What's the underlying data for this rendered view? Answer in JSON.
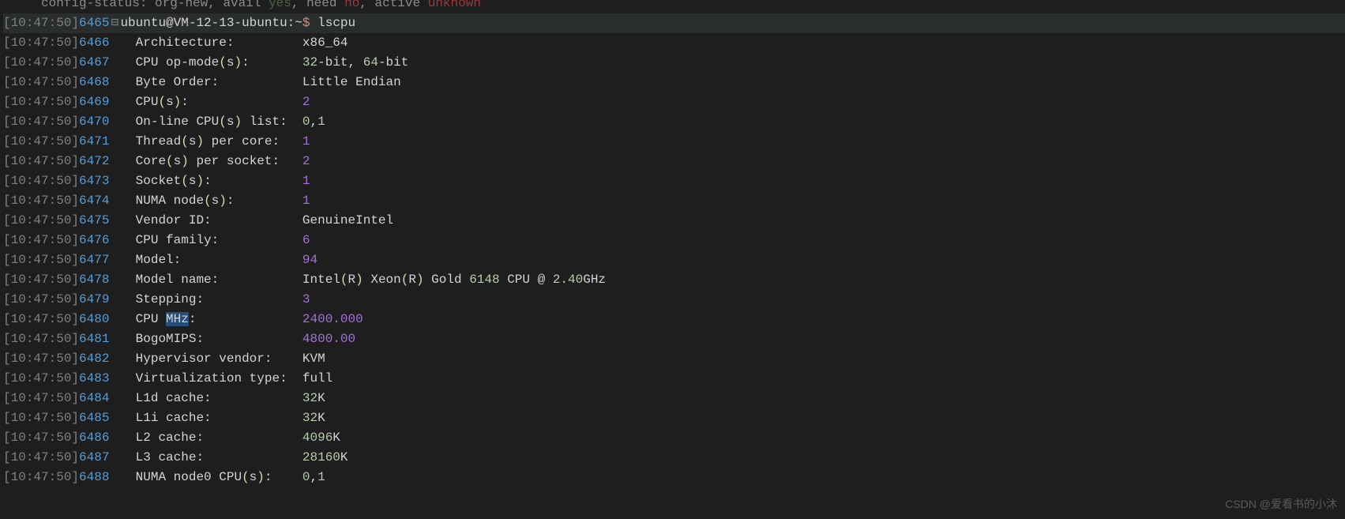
{
  "timestamp": "10:47:50",
  "first_line_no": 6465,
  "top_fragment": {
    "prefix": "     config-status: org-new, avail ",
    "yes": "yes",
    "mid1": ", need ",
    "no": "no",
    "mid2": ", active ",
    "unknown": "unknown"
  },
  "prompt": {
    "user": "ubuntu@VM-12-13-ubuntu",
    "path": "~",
    "dollar": "$",
    "cmd": "lscpu"
  },
  "rows": [
    {
      "label": "Architecture:",
      "value": "x86_64",
      "vtype": "text"
    },
    {
      "label_pre": "CPU op-mode",
      "paren": "s",
      "label_post": ":",
      "value_parts": [
        {
          "t": "num",
          "v": "32"
        },
        {
          "t": "text",
          "v": "-bit, "
        },
        {
          "t": "num",
          "v": "64"
        },
        {
          "t": "text",
          "v": "-bit"
        }
      ]
    },
    {
      "label": "Byte Order:",
      "value": "Little Endian",
      "vtype": "text"
    },
    {
      "label_pre": "CPU",
      "paren": "s",
      "label_post": ":",
      "value": "2",
      "vtype": "numv"
    },
    {
      "label_pre": "On-line CPU",
      "paren": "s",
      "label_post": " list:",
      "value_parts": [
        {
          "t": "num",
          "v": "0"
        },
        {
          "t": "text",
          "v": ","
        },
        {
          "t": "num",
          "v": "1"
        }
      ]
    },
    {
      "label_pre": "Thread",
      "paren": "s",
      "label_post": " per core:",
      "value": "1",
      "vtype": "numv"
    },
    {
      "label_pre": "Core",
      "paren": "s",
      "label_post": " per socket:",
      "value": "2",
      "vtype": "numv"
    },
    {
      "label_pre": "Socket",
      "paren": "s",
      "label_post": ":",
      "value": "1",
      "vtype": "numv"
    },
    {
      "label_pre": "NUMA node",
      "paren": "s",
      "label_post": ":",
      "value": "1",
      "vtype": "numv"
    },
    {
      "label": "Vendor ID:",
      "value": "GenuineIntel",
      "vtype": "text"
    },
    {
      "label": "CPU family:",
      "value": "6",
      "vtype": "numv"
    },
    {
      "label": "Model:",
      "value": "94",
      "vtype": "numv"
    },
    {
      "label": "Model name:",
      "value_parts": [
        {
          "t": "text",
          "v": "Intel"
        },
        {
          "t": "paren",
          "v": "("
        },
        {
          "t": "text",
          "v": "R"
        },
        {
          "t": "paren",
          "v": ")"
        },
        {
          "t": "text",
          "v": " Xeon"
        },
        {
          "t": "paren",
          "v": "("
        },
        {
          "t": "text",
          "v": "R"
        },
        {
          "t": "paren",
          "v": ")"
        },
        {
          "t": "text",
          "v": " Gold "
        },
        {
          "t": "num",
          "v": "6148"
        },
        {
          "t": "text",
          "v": " CPU @ "
        },
        {
          "t": "num",
          "v": "2.40"
        },
        {
          "t": "text",
          "v": "GHz"
        }
      ]
    },
    {
      "label": "Stepping:",
      "value": "3",
      "vtype": "numv"
    },
    {
      "label_pre": "CPU ",
      "highlight": "MHz",
      "label_post": ":",
      "value": "2400.000",
      "vtype": "numv"
    },
    {
      "label": "BogoMIPS:",
      "value": "4800.00",
      "vtype": "numv"
    },
    {
      "label": "Hypervisor vendor:",
      "value": "KVM",
      "vtype": "text"
    },
    {
      "label": "Virtualization type:",
      "value": "full",
      "vtype": "text"
    },
    {
      "label": "L1d cache:",
      "value_parts": [
        {
          "t": "num",
          "v": "32"
        },
        {
          "t": "text",
          "v": "K"
        }
      ]
    },
    {
      "label": "L1i cache:",
      "value_parts": [
        {
          "t": "num",
          "v": "32"
        },
        {
          "t": "text",
          "v": "K"
        }
      ]
    },
    {
      "label": "L2 cache:",
      "value_parts": [
        {
          "t": "num",
          "v": "4096"
        },
        {
          "t": "text",
          "v": "K"
        }
      ]
    },
    {
      "label": "L3 cache:",
      "value_parts": [
        {
          "t": "num",
          "v": "28160"
        },
        {
          "t": "text",
          "v": "K"
        }
      ]
    },
    {
      "label_pre": "NUMA node0 CPU",
      "paren": "s",
      "label_post": ":",
      "value_parts": [
        {
          "t": "num",
          "v": "0"
        },
        {
          "t": "text",
          "v": ","
        },
        {
          "t": "num",
          "v": "1"
        }
      ]
    }
  ],
  "watermark": "CSDN @爱看书的小沐",
  "label_column_width": 21
}
